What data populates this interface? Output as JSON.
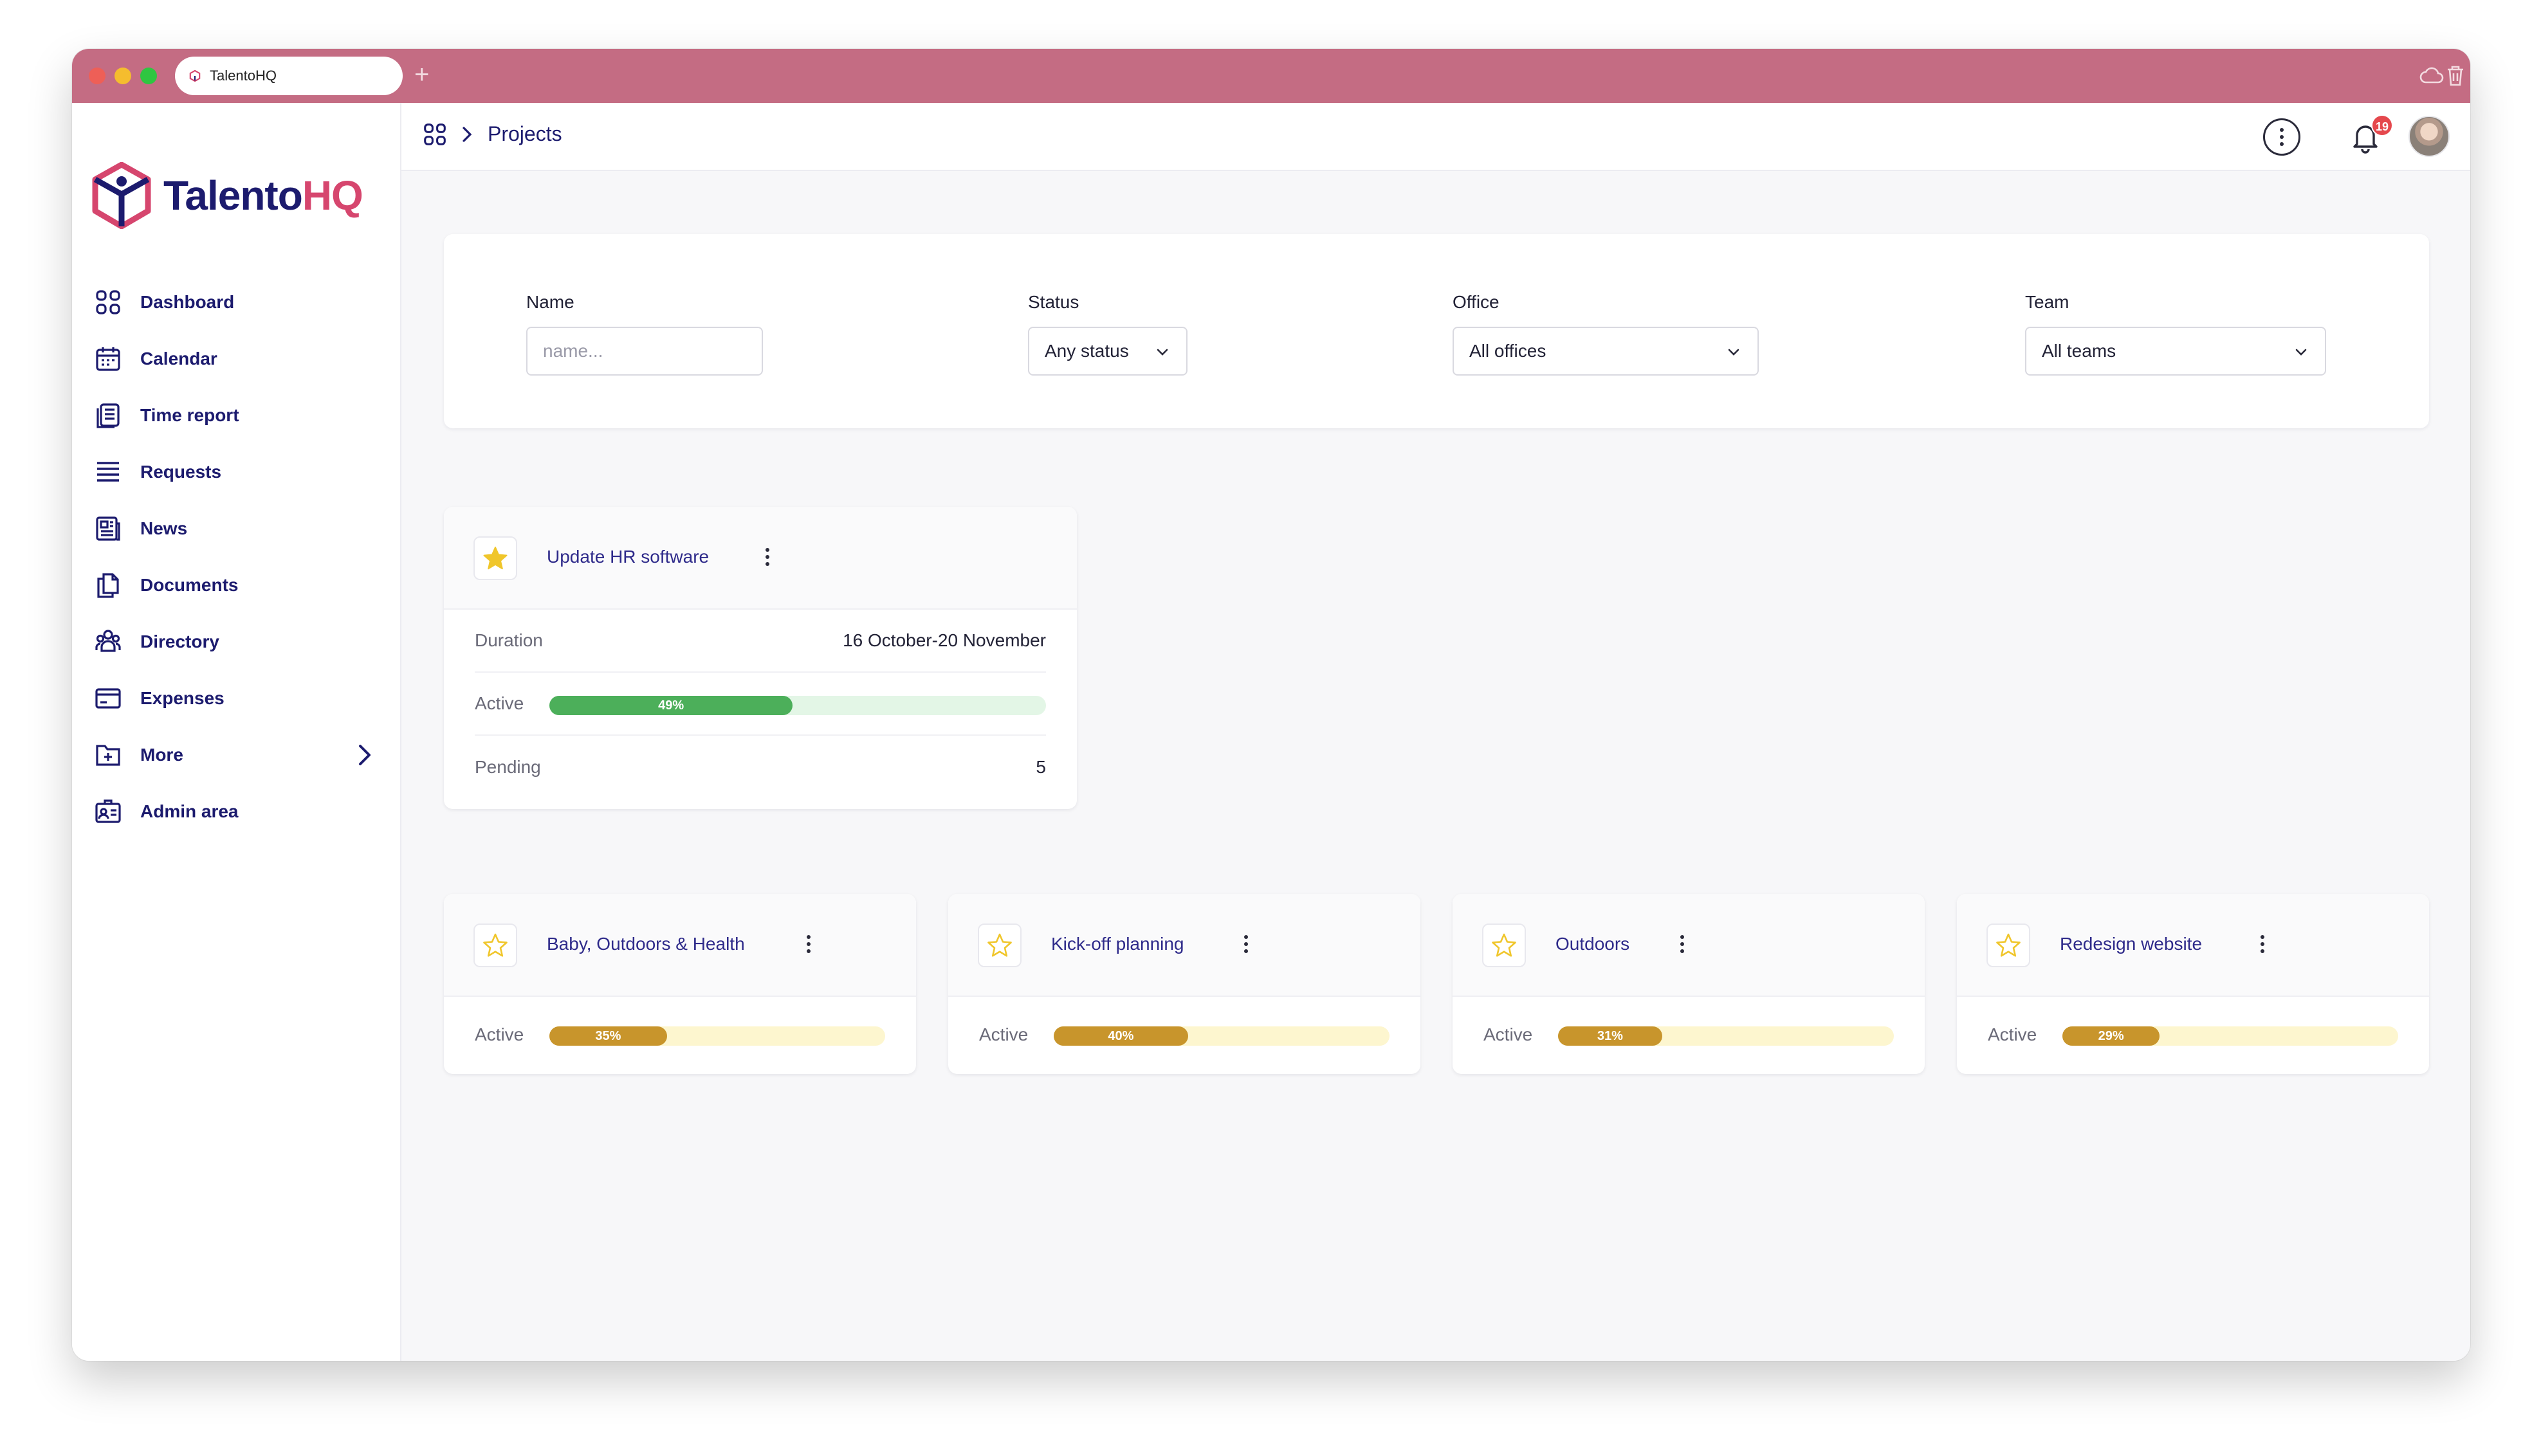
{
  "browser": {
    "tab_title": "TalentoHQ",
    "new_tab_symbol": "+",
    "colors": {
      "titlebar": "#c46c83"
    }
  },
  "brand": {
    "name_part1": "Talento",
    "name_part2": "HQ"
  },
  "sidebar": {
    "items": [
      {
        "label": "Dashboard",
        "icon": "grid-icon"
      },
      {
        "label": "Calendar",
        "icon": "calendar-icon"
      },
      {
        "label": "Time report",
        "icon": "clipboard-icon"
      },
      {
        "label": "Requests",
        "icon": "list-icon"
      },
      {
        "label": "News",
        "icon": "newspaper-icon"
      },
      {
        "label": "Documents",
        "icon": "documents-icon"
      },
      {
        "label": "Directory",
        "icon": "people-icon"
      },
      {
        "label": "Expenses",
        "icon": "credit-card-icon"
      },
      {
        "label": "More",
        "icon": "folder-plus-icon"
      },
      {
        "label": "Admin area",
        "icon": "id-card-icon"
      }
    ]
  },
  "header": {
    "breadcrumb_current": "Projects",
    "notification_count": "19"
  },
  "filters": {
    "name_label": "Name",
    "name_placeholder": "name...",
    "status_label": "Status",
    "status_value": "Any status",
    "office_label": "Office",
    "office_value": "All offices",
    "team_label": "Team",
    "team_value": "All teams"
  },
  "featured_project": {
    "title": "Update HR software",
    "starred": true,
    "duration_label": "Duration",
    "duration_value": "16 October-20 November",
    "active_label": "Active",
    "active_percent_text": "49%",
    "active_fraction": 0.49,
    "pending_label": "Pending",
    "pending_value": "5"
  },
  "projects": [
    {
      "title": "Baby, Outdoors & Health",
      "active_label": "Active",
      "percent_text": "35%",
      "fraction": 0.35
    },
    {
      "title": "Kick-off planning",
      "active_label": "Active",
      "percent_text": "40%",
      "fraction": 0.4
    },
    {
      "title": "Outdoors",
      "active_label": "Active",
      "percent_text": "31%",
      "fraction": 0.31
    },
    {
      "title": "Redesign website",
      "active_label": "Active",
      "percent_text": "29%",
      "fraction": 0.29
    }
  ],
  "colors": {
    "brand_navy": "#1c1b6e",
    "brand_pink": "#d6466e",
    "progress_green": "#4caf5a",
    "progress_green_track": "#e3f6e6",
    "progress_gold": "#c8952c",
    "progress_gold_track": "#fdf6cf",
    "star_gold": "#f0c62b"
  }
}
